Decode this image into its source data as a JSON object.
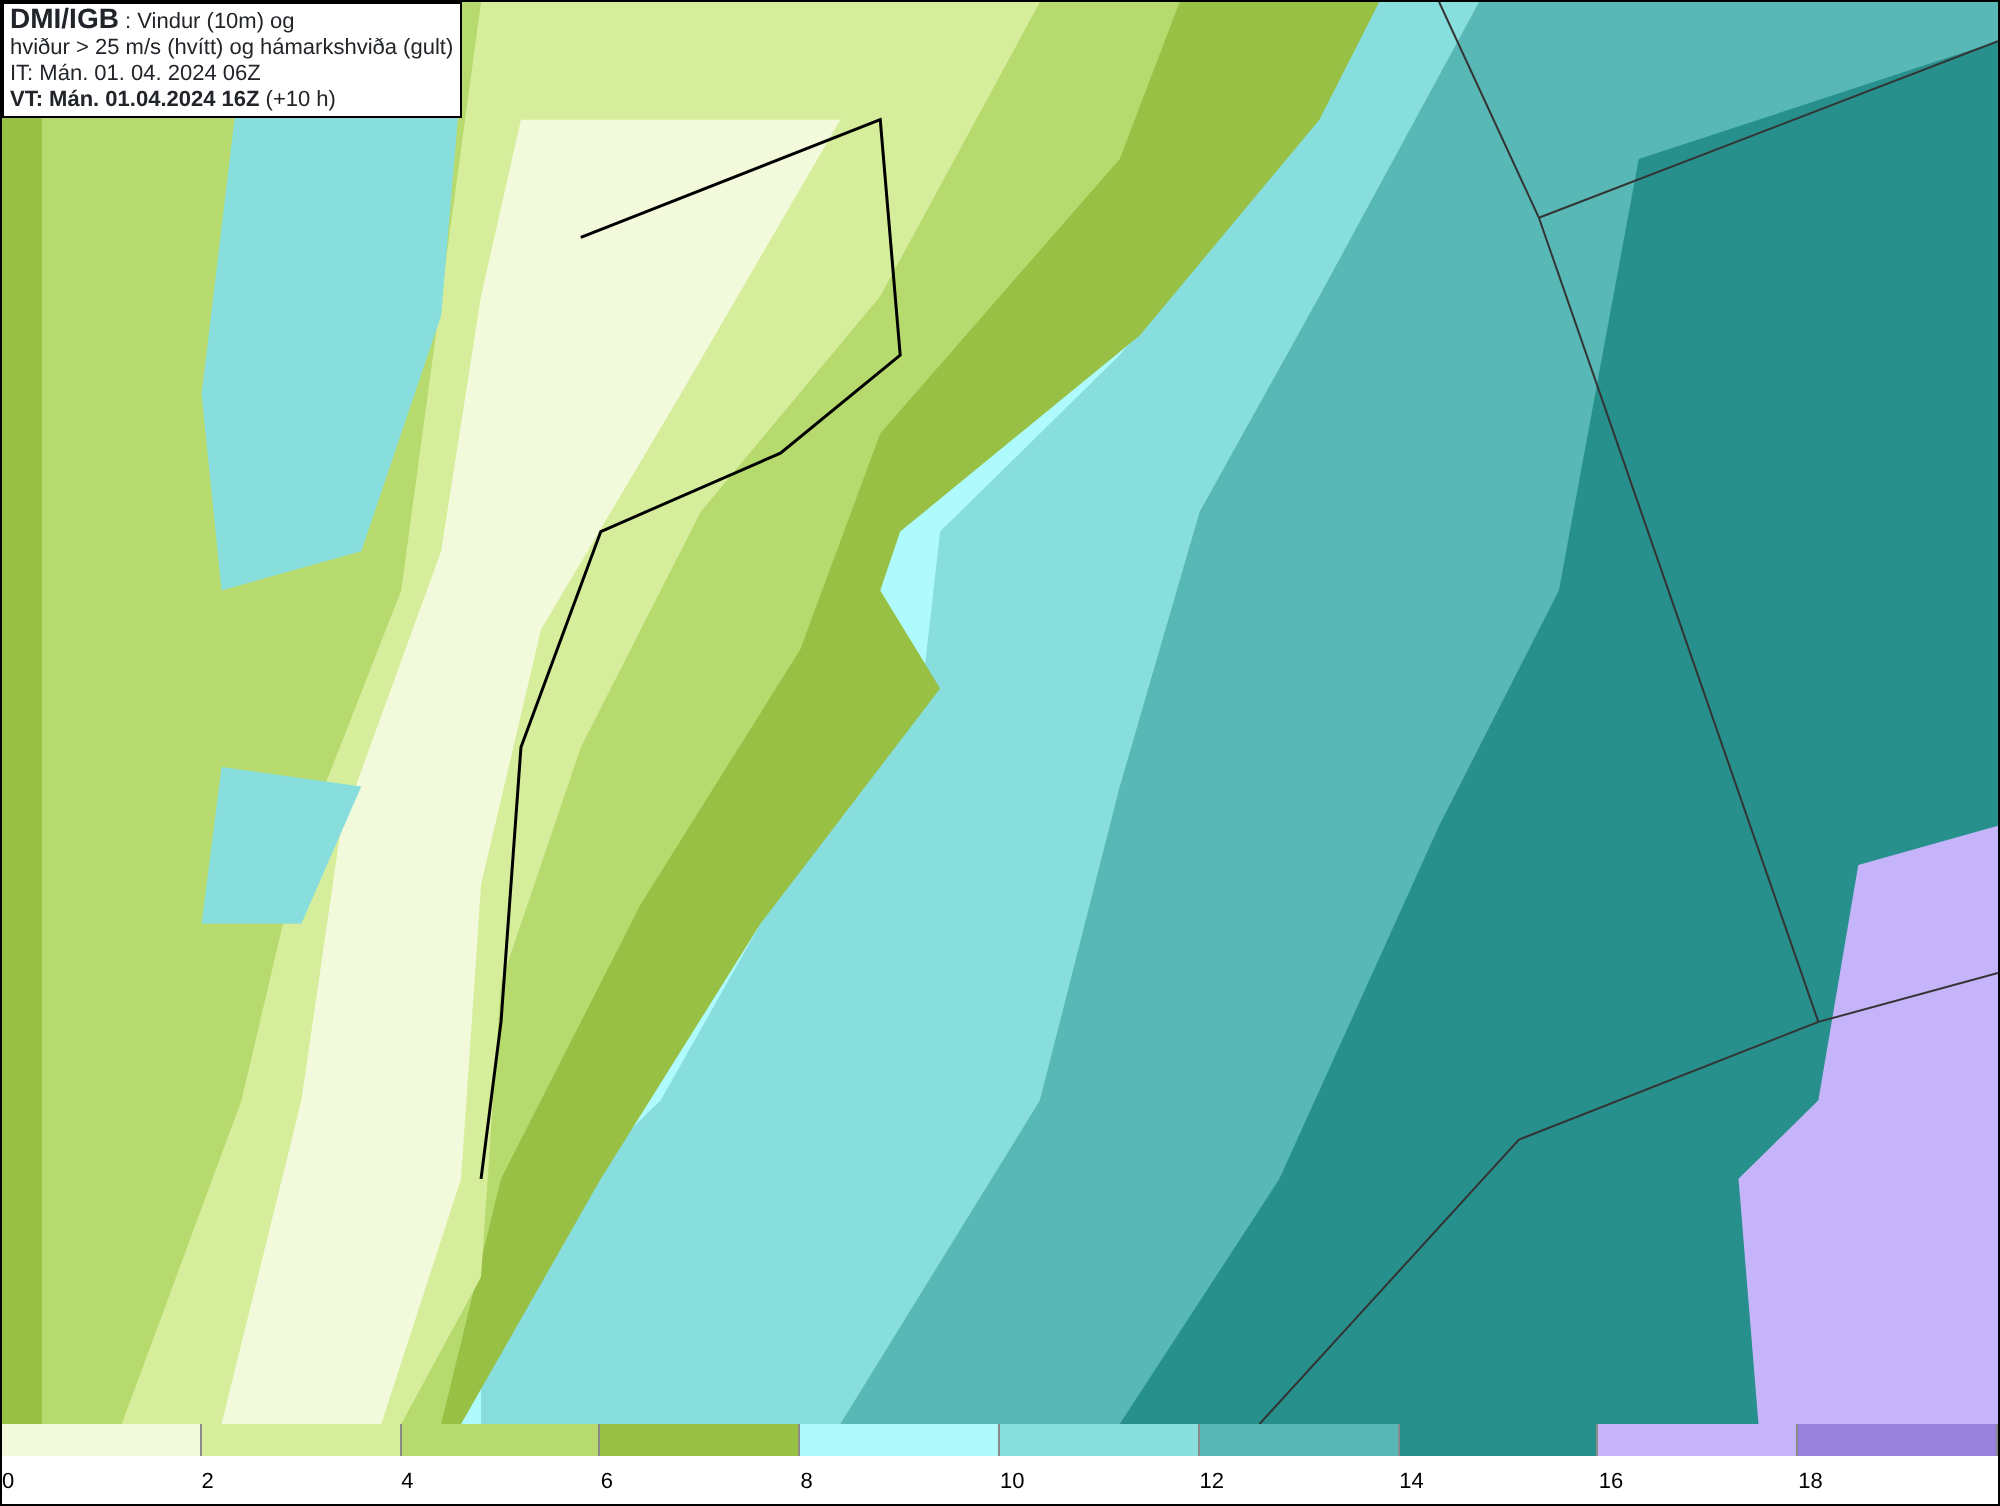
{
  "title_box": {
    "lines": [
      "**DMI/IGB** : Vindur (10m) og",
      "hviður > 25 m/s (hvítt) og hámarkshviða (gult)",
      "IT: Mán. 01. 04. 2024 06Z",
      "**VT: Mán. 01.04.2024 16Z** (+10 h)"
    ]
  },
  "legend": [
    {
      "label": "0",
      "color": "#f3fadc"
    },
    {
      "label": "2",
      "color": "#d6ee9c"
    },
    {
      "label": "4",
      "color": "#b6da6e"
    },
    {
      "label": "6",
      "color": "#97c044"
    },
    {
      "label": "8",
      "color": "#aefafc"
    },
    {
      "label": "10",
      "color": "#88dedc"
    },
    {
      "label": "12",
      "color": "#58b8b6"
    },
    {
      "label": "14",
      "color": "#27908c"
    },
    {
      "label": "16",
      "color": "#c6b4fa"
    },
    {
      "label": "18",
      "color": "#9882de"
    }
  ]
}
